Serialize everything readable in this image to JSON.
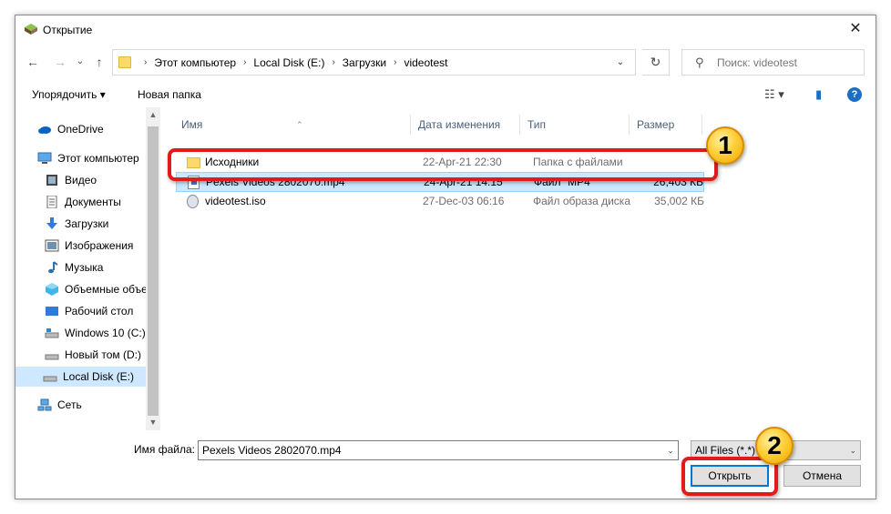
{
  "window": {
    "title": "Открытие",
    "close_glyph": "✕"
  },
  "nav": {
    "back_glyph": "←",
    "forward_glyph": "→",
    "recent_glyph": "⌄",
    "up_glyph": "↑",
    "breadcrumbs": [
      "Этот компьютер",
      "Local Disk (E:)",
      "Загрузки",
      "videotest"
    ],
    "breadcrumb_sep": "›",
    "dropdown_glyph": "⌄",
    "refresh_glyph": "↻",
    "search_glyph": "⚲",
    "search_placeholder": "Поиск: videotest"
  },
  "toolbar": {
    "organize_label": "Упорядочить ▾",
    "new_folder_label": "Новая папка",
    "view_glyph": "☷ ▾",
    "pane_glyph": "▮",
    "help_glyph": "?"
  },
  "sidebar": {
    "items": [
      {
        "label": "OneDrive",
        "icon": "cloud-icon"
      },
      {
        "label": "Этот компьютер",
        "icon": "computer-icon"
      },
      {
        "label": "Видео",
        "icon": "video-folder-icon"
      },
      {
        "label": "Документы",
        "icon": "documents-icon"
      },
      {
        "label": "Загрузки",
        "icon": "download-icon"
      },
      {
        "label": "Изображения",
        "icon": "pictures-icon"
      },
      {
        "label": "Музыка",
        "icon": "music-icon"
      },
      {
        "label": "Объемные объе",
        "icon": "3d-objects-icon"
      },
      {
        "label": "Рабочий стол",
        "icon": "desktop-icon"
      },
      {
        "label": "Windows 10 (C:)",
        "icon": "drive-icon"
      },
      {
        "label": "Новый том (D:)",
        "icon": "drive-icon"
      },
      {
        "label": "Local Disk (E:)",
        "icon": "drive-icon"
      },
      {
        "label": "Сеть",
        "icon": "network-icon"
      }
    ],
    "scroll_up_glyph": "▲",
    "scroll_down_glyph": "▼"
  },
  "filelist": {
    "columns": [
      "Имя",
      "Дата изменения",
      "Тип",
      "Размер"
    ],
    "sort_glyph": "⌃",
    "rows": [
      {
        "name": "Исходники",
        "date": "22-Apr-21 22:30",
        "type": "Папка с файлами",
        "size": "",
        "icon": "folder-icon"
      },
      {
        "name": "Pexels Videos 2802070.mp4",
        "date": "24-Apr-21 14:15",
        "type": "Файл \"MP4\"",
        "size": "26,403 КБ",
        "icon": "video-file-icon"
      },
      {
        "name": "videotest.iso",
        "date": "27-Dec-03 06:16",
        "type": "Файл образа диска",
        "size": "35,002 КБ",
        "icon": "disc-image-icon"
      }
    ]
  },
  "footer": {
    "filename_label": "Имя файла:",
    "filename_value": "Pexels Videos 2802070.mp4",
    "filetype_value": "All Files (*.*)",
    "open_label": "Открыть",
    "cancel_label": "Отмена",
    "dropdown_glyph": "⌄"
  },
  "annotations": {
    "step1": "1",
    "step2": "2",
    "color": "#e31a1a"
  }
}
